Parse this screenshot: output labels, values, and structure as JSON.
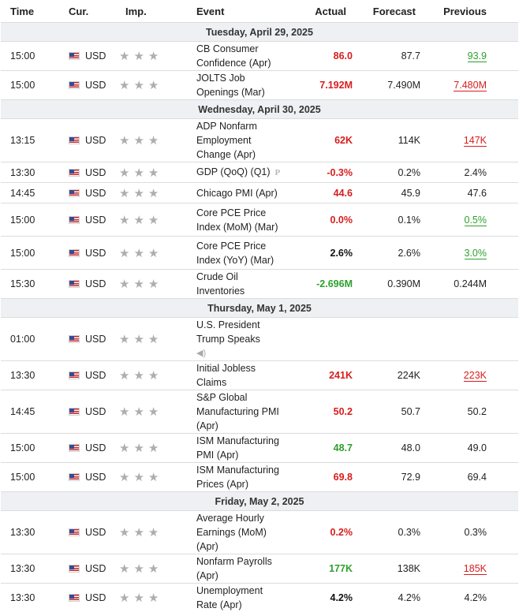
{
  "columns": {
    "time": "Time",
    "cur": "Cur.",
    "imp": "Imp.",
    "event": "Event",
    "actual": "Actual",
    "forecast": "Forecast",
    "previous": "Previous"
  },
  "colors": {
    "red": "#d81d1d",
    "green": "#2ea02e",
    "star": "#aeaeae"
  },
  "days": [
    {
      "label": "Tuesday, April 29, 2025",
      "rows": [
        {
          "time": "15:00",
          "cur": "USD",
          "imp": 3,
          "event": "CB Consumer Confidence (Apr)",
          "actual": "86.0",
          "actual_color": "red",
          "forecast": "87.7",
          "previous": "93.9",
          "previous_style": "green",
          "lines": 1
        },
        {
          "time": "15:00",
          "cur": "USD",
          "imp": 3,
          "event": "JOLTS Job Openings (Mar)",
          "actual": "7.192M",
          "actual_color": "red",
          "forecast": "7.490M",
          "previous": "7.480M",
          "previous_style": "red",
          "lines": 1
        }
      ]
    },
    {
      "label": "Wednesday, April 30, 2025",
      "rows": [
        {
          "time": "13:15",
          "cur": "USD",
          "imp": 3,
          "event": "ADP Nonfarm Employment Change (Apr)",
          "actual": "62K",
          "actual_color": "red",
          "forecast": "114K",
          "previous": "147K",
          "previous_style": "red",
          "lines": 2
        },
        {
          "time": "13:30",
          "cur": "USD",
          "imp": 3,
          "event": "GDP (QoQ) (Q1)",
          "tag": "P",
          "actual": "-0.3%",
          "actual_color": "red",
          "forecast": "0.2%",
          "previous": "2.4%",
          "previous_style": "plain",
          "lines": 1
        },
        {
          "time": "14:45",
          "cur": "USD",
          "imp": 3,
          "event": "Chicago PMI (Apr)",
          "actual": "44.6",
          "actual_color": "red",
          "forecast": "45.9",
          "previous": "47.6",
          "previous_style": "plain",
          "lines": 1
        },
        {
          "time": "15:00",
          "cur": "USD",
          "imp": 3,
          "event": "Core PCE Price Index (MoM) (Mar)",
          "actual": "0.0%",
          "actual_color": "red",
          "forecast": "0.1%",
          "previous": "0.5%",
          "previous_style": "green",
          "lines": 2
        },
        {
          "time": "15:00",
          "cur": "USD",
          "imp": 3,
          "event": "Core PCE Price Index (YoY) (Mar)",
          "actual": "2.6%",
          "actual_color": "neutral",
          "forecast": "2.6%",
          "previous": "3.0%",
          "previous_style": "green",
          "lines": 2
        },
        {
          "time": "15:30",
          "cur": "USD",
          "imp": 3,
          "event": "Crude Oil Inventories",
          "actual": "-2.696M",
          "actual_color": "green",
          "forecast": "0.390M",
          "previous": "0.244M",
          "previous_style": "plain",
          "lines": 1
        }
      ]
    },
    {
      "label": "Thursday, May 1, 2025",
      "rows": [
        {
          "time": "01:00",
          "cur": "USD",
          "imp": 3,
          "event": "U.S. President Trump Speaks",
          "speaker": true,
          "actual": "",
          "actual_color": "plain",
          "forecast": "",
          "previous": "",
          "previous_style": "plain",
          "lines": 2
        },
        {
          "time": "13:30",
          "cur": "USD",
          "imp": 3,
          "event": "Initial Jobless Claims",
          "actual": "241K",
          "actual_color": "red",
          "forecast": "224K",
          "previous": "223K",
          "previous_style": "red",
          "lines": 1
        },
        {
          "time": "14:45",
          "cur": "USD",
          "imp": 3,
          "event": "S&P Global Manufacturing PMI (Apr)",
          "actual": "50.2",
          "actual_color": "red",
          "forecast": "50.7",
          "previous": "50.2",
          "previous_style": "plain",
          "lines": 2
        },
        {
          "time": "15:00",
          "cur": "USD",
          "imp": 3,
          "event": "ISM Manufacturing PMI (Apr)",
          "actual": "48.7",
          "actual_color": "green",
          "forecast": "48.0",
          "previous": "49.0",
          "previous_style": "plain",
          "lines": 1
        },
        {
          "time": "15:00",
          "cur": "USD",
          "imp": 3,
          "event": "ISM Manufacturing Prices (Apr)",
          "actual": "69.8",
          "actual_color": "red",
          "forecast": "72.9",
          "previous": "69.4",
          "previous_style": "plain",
          "lines": 1
        }
      ]
    },
    {
      "label": "Friday, May 2, 2025",
      "rows": [
        {
          "time": "13:30",
          "cur": "USD",
          "imp": 3,
          "event": "Average Hourly Earnings (MoM) (Apr)",
          "actual": "0.2%",
          "actual_color": "red",
          "forecast": "0.3%",
          "previous": "0.3%",
          "previous_style": "plain",
          "lines": 2
        },
        {
          "time": "13:30",
          "cur": "USD",
          "imp": 3,
          "event": "Nonfarm Payrolls (Apr)",
          "actual": "177K",
          "actual_color": "green",
          "forecast": "138K",
          "previous": "185K",
          "previous_style": "red",
          "lines": 1
        },
        {
          "time": "13:30",
          "cur": "USD",
          "imp": 3,
          "event": "Unemployment Rate (Apr)",
          "actual": "4.2%",
          "actual_color": "neutral",
          "forecast": "4.2%",
          "previous": "4.2%",
          "previous_style": "plain",
          "lines": 1
        }
      ]
    }
  ]
}
